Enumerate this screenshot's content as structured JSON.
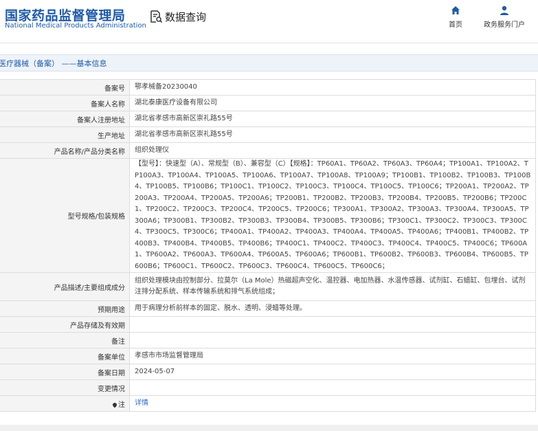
{
  "header": {
    "logo_cn": "国家药品监督管理局",
    "logo_en": "National Medical Products Administration",
    "query_title": "数据查询",
    "nav": [
      {
        "label": "首页",
        "icon": "home-icon"
      },
      {
        "label": "政务服务门户",
        "icon": "user-icon"
      }
    ]
  },
  "breadcrumb": "医疗器械（备案） ——基本信息",
  "colors": {
    "brand": "#1f5aa8",
    "link": "#2d6cc5",
    "label_bg": "#f4f4f4"
  },
  "rows": [
    {
      "label": "备案号",
      "value": "鄂孝械备20230040"
    },
    {
      "label": "备案人名称",
      "value": "湖北泰康医疗设备有限公司"
    },
    {
      "label": "备案人注册地址",
      "value": "湖北省孝感市高新区崇礼路55号"
    },
    {
      "label": "生产地址",
      "value": "湖北省孝感市高新区崇礼路55号"
    },
    {
      "label": "产品名称/产品分类名称",
      "value": "组织处理仪"
    },
    {
      "label": "型号规格/包装规格",
      "value": "【型号】：快速型（A）、常规型（B）、兼容型（C）【规格】：TP60A1、TP60A2、TP60A3、TP60A4；TP100A1、TP100A2、TP100A3、TP100A4、TP100A5、TP100A6、TP100A7、TP100A8、TP100A9；TP100B1、TP100B2、TP100B3、TP100B4、TP100B5、TP100B6；TP100C1、TP100C2、TP100C3、TP100C4、TP100C5、TP100C6；TP200A1、TP200A2、TP200A3、TP200A4、TP200A5、TP200A6；TP200B1、TP200B2、TP200B3、TP200B4、TP200B5、TP200B6；TP200C1、TP200C2、TP200C3、TP200C4、TP200C5、TP200C6；TP300A1、TP300A2、TP300A3、TP300A4、TP300A5、TP300A6；TP300B1、TP300B2、TP300B3、TP300B4、TP300B5、TP300B6；TP300C1、TP300C2、TP300C3、TP300C4、TP300C5、TP300C6；TP400A1、TP400A2、TP400A3、TP400A4、TP400A5、TP400A6；TP400B1、TP400B2、TP400B3、TP400B4、TP400B5、TP400B6；TP400C1、TP400C2、TP400C3、TP400C4、TP400C5、TP400C6；TP600A1、TP600A2、TP600A3、TP600A4、TP600A5、TP600A6；TP600B1、TP600B2、TP600B3、TP600B4、TP600B5、TP600B6；TP600C1、TP600C2、TP600C3、TP600C4、TP600C5、TP600C6；"
    },
    {
      "label": "产品描述/主要组成成分",
      "value": "组织处理模块由控制部分、拉莫尔（La Mole）热磁超声空化、温控器、电加热器、水温传感器、试剂缸、石蜡缸、包埋台、试剂注排分配系统、样本传输系统和排气系统组成；"
    },
    {
      "label": "预期用途",
      "value": "用于病理分析前样本的固定、脱水、透明、浸蜡等处理。"
    },
    {
      "label": "产品存储及有效期",
      "value": ""
    },
    {
      "label": "备注",
      "value": ""
    },
    {
      "label": "备案单位",
      "value": "孝感市市场监督管理局"
    },
    {
      "label": "备案日期",
      "value": "2024-05-07"
    },
    {
      "label": "变更情况",
      "value": ""
    }
  ],
  "note_row": {
    "label": "注",
    "link": "详情",
    "icon": "pin-icon"
  }
}
